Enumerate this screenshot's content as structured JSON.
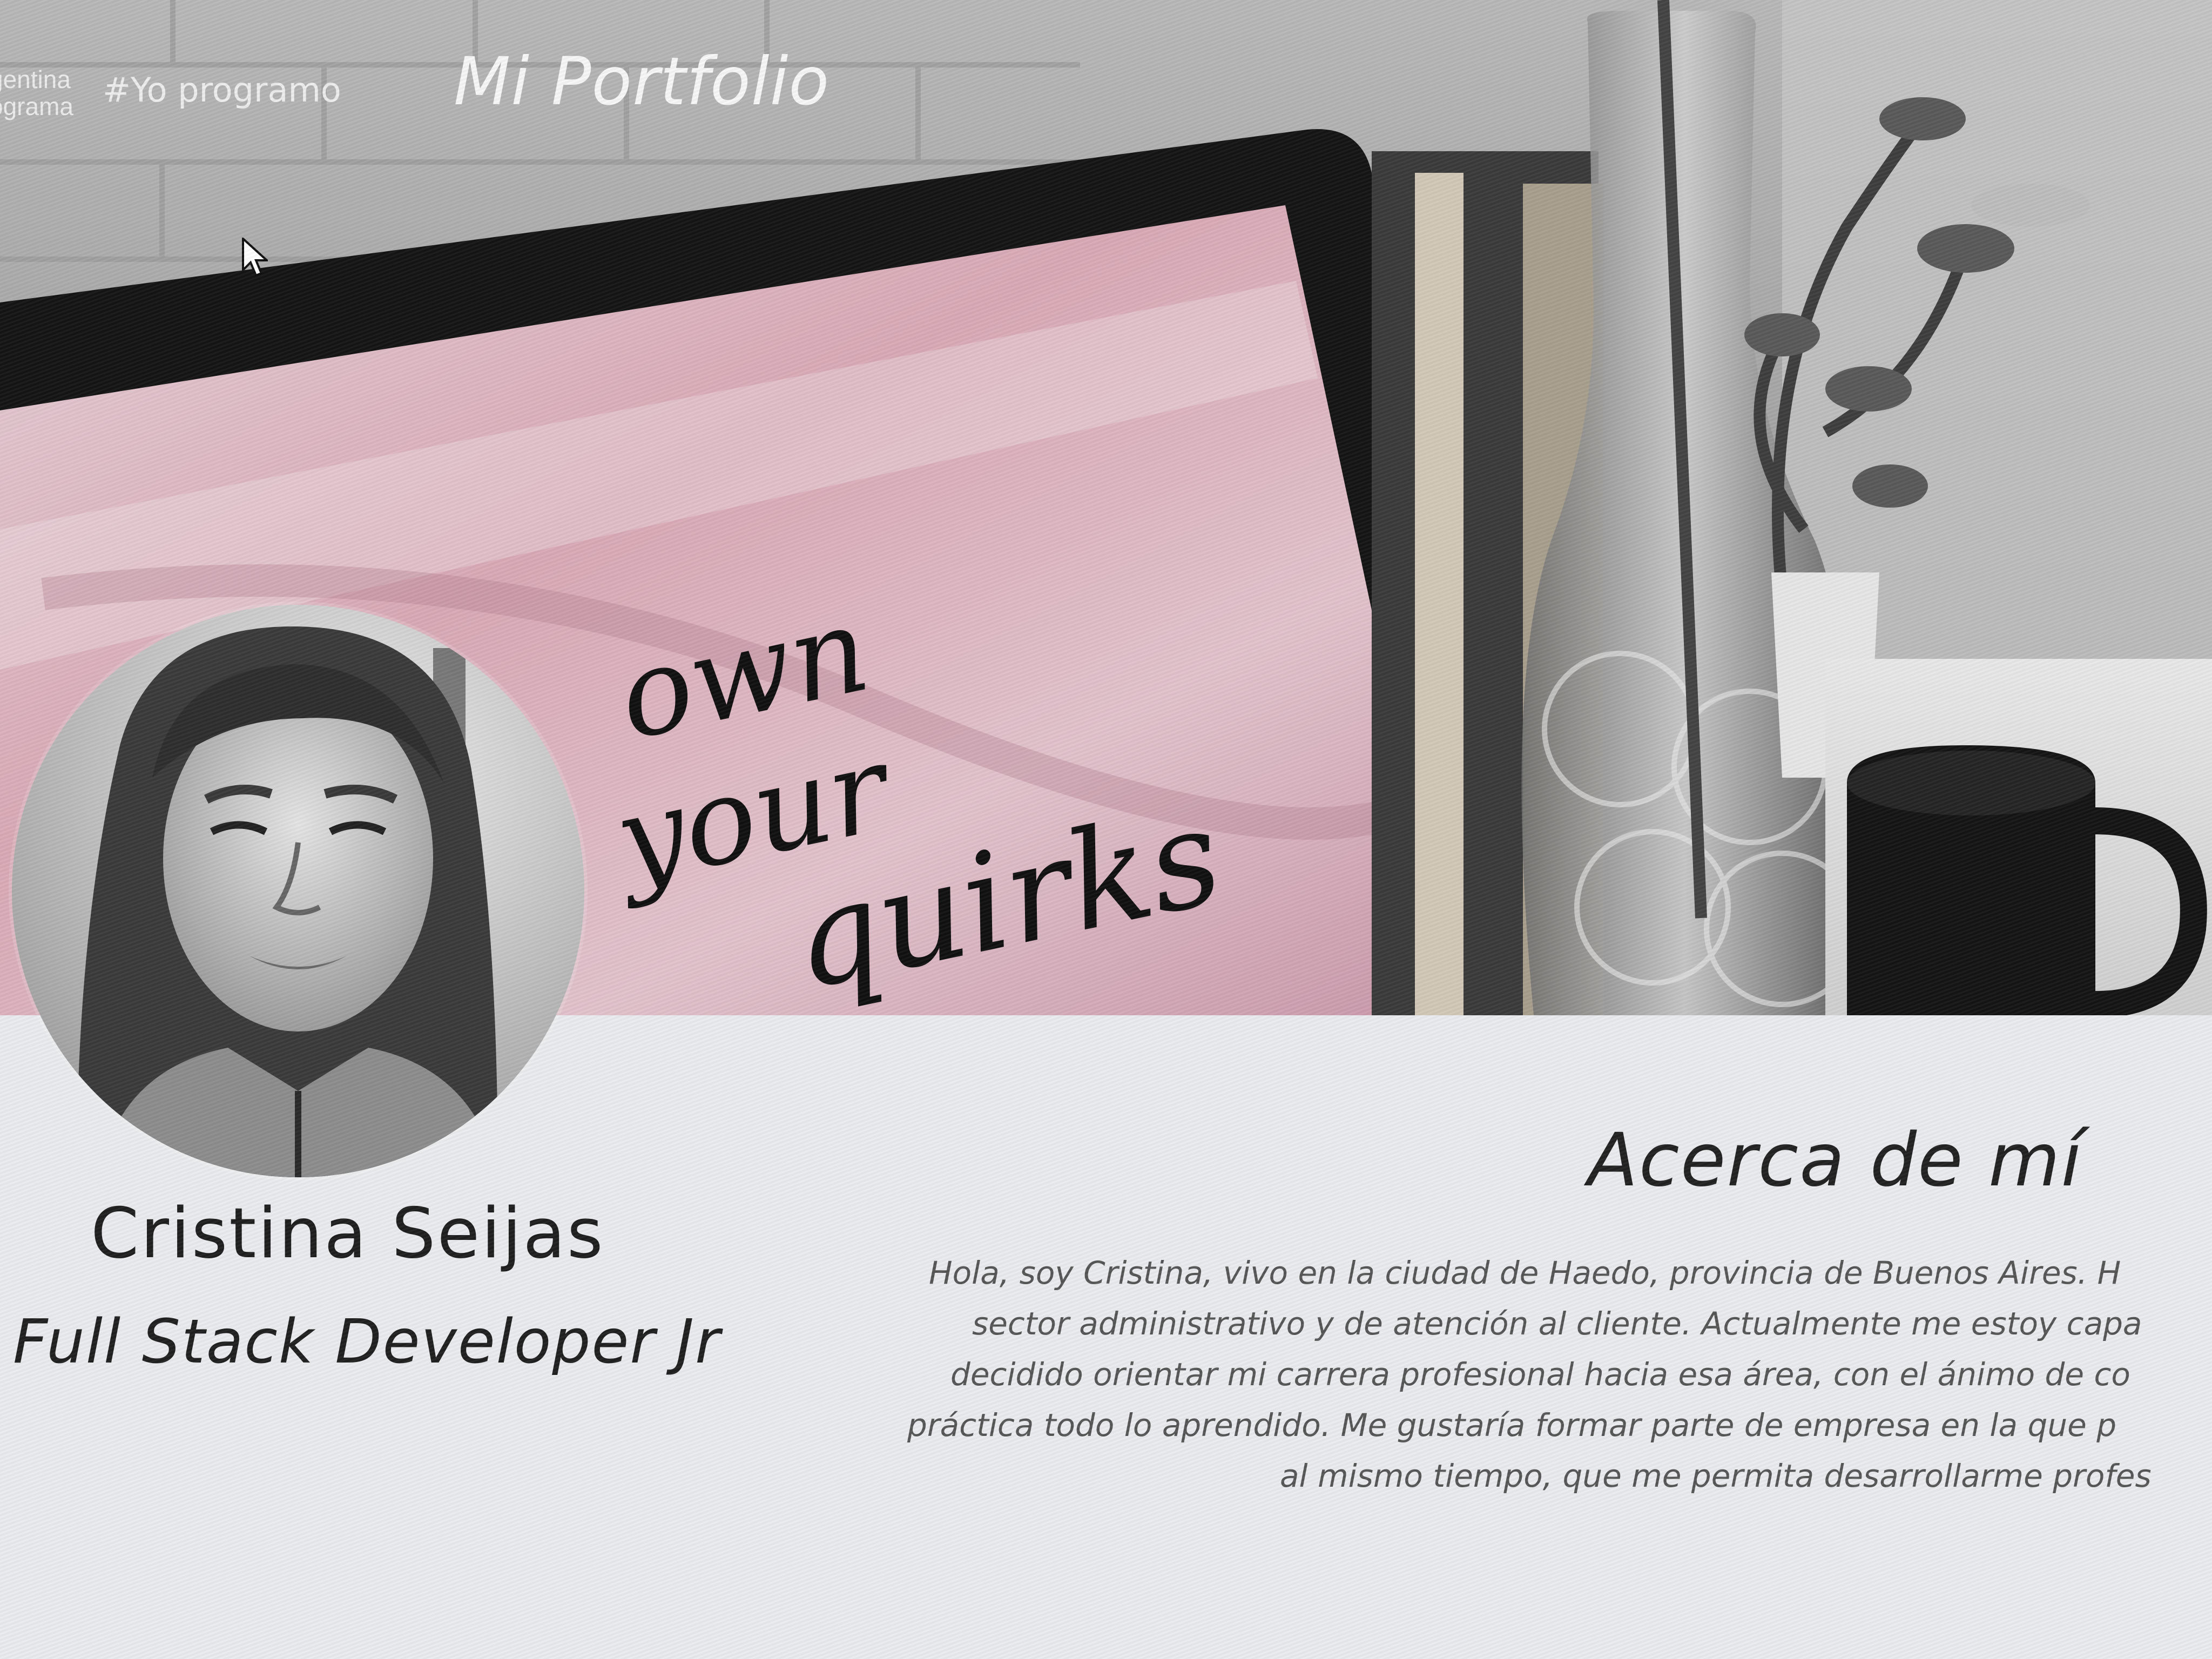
{
  "navbar": {
    "brand_line1": "gentina",
    "brand_line2": "ograma",
    "hashtag": "#Yo programo",
    "title": "Mi Portfolio"
  },
  "banner": {
    "quote_line1": "own",
    "quote_line2": "your",
    "quote_line3": "quirks"
  },
  "profile": {
    "name": "Cristina Seijas",
    "role": "Full Stack Developer Jr"
  },
  "about": {
    "title": "Acerca de mí",
    "lines": [
      "Hola, soy Cristina, vivo en la ciudad de Haedo, provincia de Buenos Aires. H",
      "sector administrativo y de atención al cliente. Actualmente me estoy capa",
      "decidido orientar mi carrera profesional hacia esa área, con el ánimo de co",
      "práctica todo lo aprendido. Me gustaría formar parte de empresa en la que p",
      "al mismo tiempo, que me permita desarrollarme profes"
    ]
  },
  "icons": {
    "cursor": "mouse-pointer-icon"
  }
}
